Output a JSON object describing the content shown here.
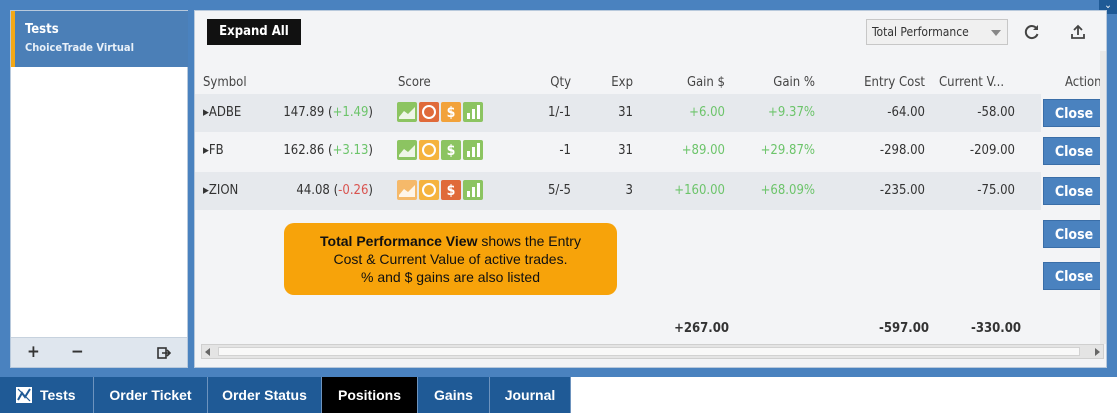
{
  "window": {
    "collapse_icon": "chevron-down-icon"
  },
  "sidebar": {
    "account_name": "Tests",
    "account_sub": "ChoiceTrade Virtual",
    "add_label": "+",
    "remove_label": "−",
    "export_icon": "sign-out-icon"
  },
  "toolbar": {
    "expand_label": "Expand All",
    "view_select_value": "Total Performance",
    "refresh_icon": "refresh-icon",
    "upload_icon": "upload-icon"
  },
  "table": {
    "headers": {
      "symbol": "Symbol",
      "score": "Score",
      "qty": "Qty",
      "exp": "Exp",
      "gain_usd": "Gain $",
      "gain_pct": "Gain %",
      "entry_cost": "Entry Cost",
      "current_value": "Current V...",
      "action": "Action"
    },
    "rows": [
      {
        "symbol": "▸ADBE",
        "price": "147.89",
        "change": "(+1.49)",
        "change_dir": "up",
        "score_colors": [
          "#8cc461",
          "#e06a3a",
          "#f2a23a",
          "#8cc461"
        ],
        "qty": "1/-1",
        "exp": "31",
        "gain_usd": "+6.00",
        "gain_pct": "+9.37%",
        "entry_cost": "-64.00",
        "current_value": "-58.00",
        "action": "Close"
      },
      {
        "symbol": "▸FB",
        "price": "162.86",
        "change": "(+3.13)",
        "change_dir": "up",
        "score_colors": [
          "#8cc461",
          "#f5b33e",
          "#8cc461",
          "#8cc461"
        ],
        "qty": "-1",
        "exp": "31",
        "gain_usd": "+89.00",
        "gain_pct": "+29.87%",
        "entry_cost": "-298.00",
        "current_value": "-209.00",
        "action": "Close"
      },
      {
        "symbol": "▸ZION",
        "price": "44.08",
        "change": "(-0.26)",
        "change_dir": "down",
        "score_colors": [
          "#f5b96a",
          "#f5b33e",
          "#e06a3a",
          "#8cc461"
        ],
        "qty": "5/-5",
        "exp": "3",
        "gain_usd": "+160.00",
        "gain_pct": "+68.09%",
        "entry_cost": "-235.00",
        "current_value": "-75.00",
        "action": "Close"
      }
    ],
    "extra_actions": [
      "Close",
      "Close"
    ],
    "totals": {
      "gain_usd": "+267.00",
      "entry_cost": "-597.00",
      "current_value": "-330.00"
    }
  },
  "callout": {
    "bold": "Total Performance View",
    "line1_rest": " shows the Entry",
    "line2": "Cost & Current Value of active trades.",
    "line3": "% and $ gains are also listed"
  },
  "tabs": [
    {
      "label": "Tests",
      "icon": "chart-icon",
      "active": false
    },
    {
      "label": "Order Ticket",
      "active": false
    },
    {
      "label": "Order Status",
      "active": false
    },
    {
      "label": "Positions",
      "active": true
    },
    {
      "label": "Gains",
      "active": false
    },
    {
      "label": "Journal",
      "active": false
    }
  ],
  "colors": {
    "accent": "#4a82bf",
    "positive": "#6cc46a",
    "negative": "#d9534f",
    "callout": "#f7a30a",
    "account_stripe": "#f2a818"
  }
}
